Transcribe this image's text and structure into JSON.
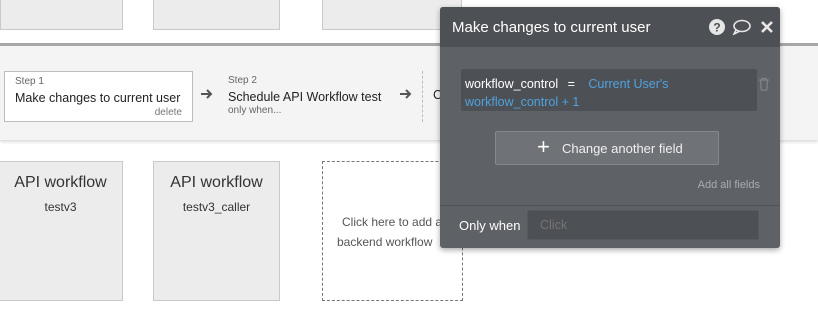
{
  "workflow_bar": {
    "steps": [
      {
        "label": "Step 1",
        "name": "Make changes to current user",
        "delete": "delete"
      },
      {
        "label": "Step 2",
        "name": "Schedule API Workflow test",
        "condition": "only when..."
      },
      {
        "partial": "C"
      }
    ]
  },
  "cards": [
    {
      "title": "API workflow",
      "subtitle": "testv3"
    },
    {
      "title": "API workflow",
      "subtitle": "testv3_caller"
    }
  ],
  "add_card": {
    "line1": "Click here to add a",
    "line2": "backend workflow"
  },
  "panel": {
    "title": "Make changes to current user",
    "field": {
      "name": "workflow_control",
      "operator": "=",
      "value_line1": "Current User's",
      "value_line2": "workflow_control + 1"
    },
    "change_button": "Change another field",
    "add_all": "Add all fields",
    "only_when_label": "Only when",
    "only_when_placeholder": "Click"
  },
  "colors": {
    "panel_bg": "#5e6165",
    "accent_blue": "#4fa3e0"
  },
  "icons": [
    "help-icon",
    "comment-icon",
    "close-icon",
    "trash-icon",
    "arrow-right-icon",
    "plus-icon"
  ]
}
